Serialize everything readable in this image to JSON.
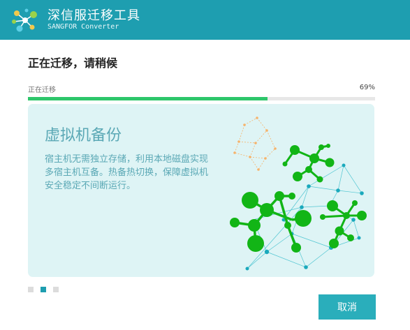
{
  "window": {
    "title": "深信服迁移工具",
    "subtitle": "SANGFOR Converter",
    "logo": "sangfor-converter-logo",
    "accent_color": "#1e9eb0"
  },
  "main": {
    "heading": "正在迁移，请稍候",
    "progress": {
      "label": "正在迁移",
      "value": 69,
      "value_text": "69%",
      "color": "#2ec66b"
    },
    "slide": {
      "title": "虚拟机备份",
      "description": "宿主机无需独立存储，利用本地磁盘实现多宿主机互备。热备热切换，保障虚拟机安全稳定不间断运行。",
      "illustration": "network-molecule-graphic"
    },
    "pager": {
      "count": 3,
      "active_index": 1
    }
  },
  "footer": {
    "cancel_label": "取消"
  }
}
